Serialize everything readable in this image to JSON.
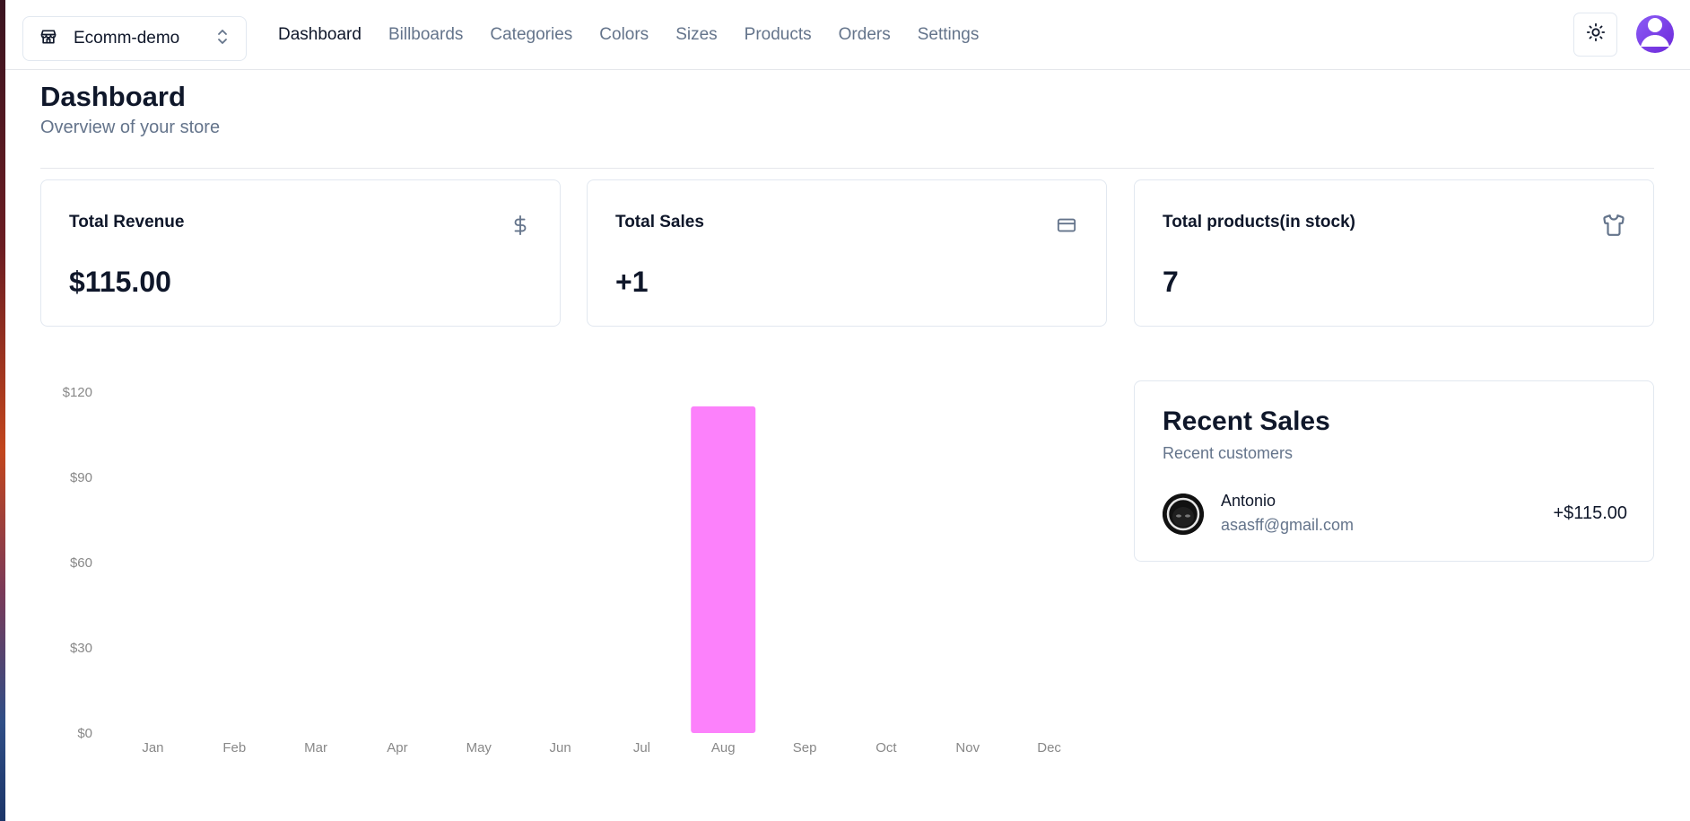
{
  "header": {
    "store_name": "Ecomm-demo",
    "nav": [
      {
        "label": "Dashboard",
        "active": true
      },
      {
        "label": "Billboards"
      },
      {
        "label": "Categories"
      },
      {
        "label": "Colors"
      },
      {
        "label": "Sizes"
      },
      {
        "label": "Products"
      },
      {
        "label": "Orders"
      },
      {
        "label": "Settings"
      }
    ]
  },
  "page": {
    "title": "Dashboard",
    "subtitle": "Overview of your store"
  },
  "cards": [
    {
      "title": "Total Revenue",
      "value": "$115.00",
      "icon": "dollar-sign-icon"
    },
    {
      "title": "Total Sales",
      "value": "+1",
      "icon": "credit-card-icon"
    },
    {
      "title": "Total products(in stock)",
      "value": "7",
      "icon": "shirt-icon"
    }
  ],
  "recent_sales": {
    "title": "Recent Sales",
    "subtitle": "Recent customers",
    "items": [
      {
        "name": "Antonio",
        "email": "asasff@gmail.com",
        "amount": "+$115.00"
      }
    ]
  },
  "colors": {
    "bar": "#fc81fb",
    "muted_text": "#64748b",
    "border": "#e2e8f0",
    "avatar": "#7c3aed"
  },
  "chart_data": {
    "type": "bar",
    "categories": [
      "Jan",
      "Feb",
      "Mar",
      "Apr",
      "May",
      "Jun",
      "Jul",
      "Aug",
      "Sep",
      "Oct",
      "Nov",
      "Dec"
    ],
    "values": [
      0,
      0,
      0,
      0,
      0,
      0,
      0,
      115,
      0,
      0,
      0,
      0
    ],
    "ytick_labels": [
      "$0",
      "$30",
      "$60",
      "$90",
      "$120"
    ],
    "yticks": [
      0,
      30,
      60,
      90,
      120
    ],
    "ylim": [
      0,
      120
    ],
    "title": "",
    "xlabel": "",
    "ylabel": "",
    "grid": false
  }
}
